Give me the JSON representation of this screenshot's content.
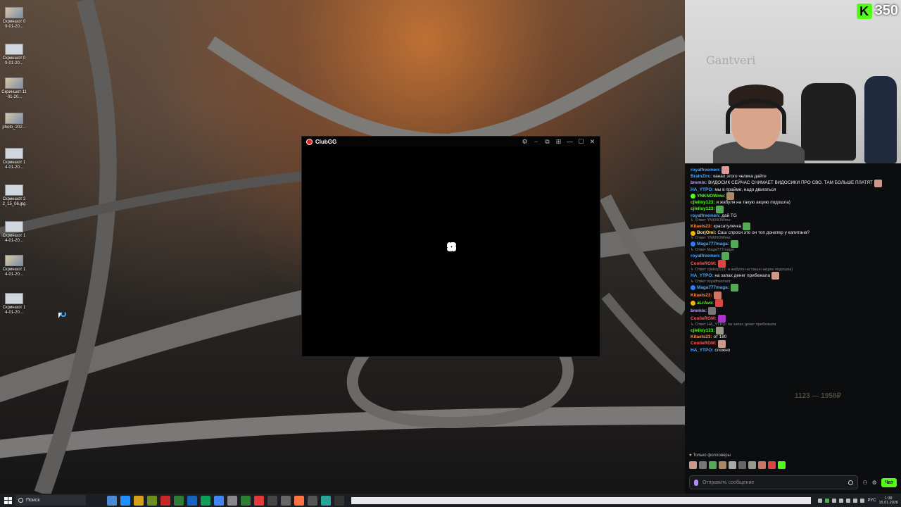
{
  "desktop": {
    "icons": [
      {
        "label": "Скриншот 09-01-20..."
      },
      {
        "label": "Скриншот 09-01-20..."
      },
      {
        "label": "Скриншот 11-01-20..."
      },
      {
        "label": "photo_202..."
      },
      {
        "label": "Скриншот 14-01-20..."
      },
      {
        "label": "Скриншот 22_15_06.jpg"
      },
      {
        "label": "Скриншот 14-01-20..."
      },
      {
        "label": "Скриншот 14-01-20..."
      },
      {
        "label": "Скриншот 14-01-20..."
      }
    ]
  },
  "app_window": {
    "title": "ClubGG",
    "controls": {
      "settings": "⚙",
      "pin": "⎯",
      "restore": "⧉",
      "grid": "⊞",
      "minimize": "—",
      "maximize": "☐",
      "close": "✕"
    }
  },
  "stream": {
    "platform_icon": "K",
    "viewer_count": "350",
    "wall_text": "Gantveri"
  },
  "chat": {
    "messages": [
      {
        "user": "royalfreemen:",
        "text": "",
        "color": "#4da6ff",
        "emote": "#d99"
      },
      {
        "user": "BrainZirc:",
        "text": "канал этого челика дайте",
        "color": "#4da6ff"
      },
      {
        "user": "bremix:",
        "text": "ВИДОСИК СЕЙЧАС СНИМАЕТ ВИДОСИКИ ПРО СВО. ТАМ БОЛЬШЕ ПЛАТЯТ",
        "color": "#c9a0ff",
        "emote": "#c98"
      },
      {
        "user": "HA_YTPO:",
        "text": "мы в прайме, надо двигаться",
        "color": "#4da6ff"
      },
      {
        "user": "YNKNOWme:",
        "text": "",
        "color": "#53fc18",
        "emote": "#a86",
        "badge": "#53fc18"
      },
      {
        "user": "cjleiloy123:",
        "text": "и жабуля на такую акцию подошла)",
        "color": "#53fc18"
      },
      {
        "user": "cjleiloy123:",
        "text": "",
        "color": "#53fc18",
        "emote": "#5a5"
      },
      {
        "user": "royalfreemen:",
        "text": "дай TG",
        "color": "#4da6ff"
      },
      {
        "reply": "Ответ YNKNOWme:"
      },
      {
        "user": "Kitaets23:",
        "text": "красатулечка",
        "color": "#ff8c42",
        "emote": "#5a5"
      },
      {
        "user": "BorjOmi:",
        "text": "Саш спроси это он топ донатер у капитана?",
        "color": "#ffe36e",
        "badge": "#f5b400"
      },
      {
        "reply": "Ответ YNKNOWme:"
      },
      {
        "user": "Maga777maga:",
        "text": "",
        "color": "#4da6ff",
        "emote": "#5a5",
        "badge": "#2d7cff"
      },
      {
        "reply": "Ответ Maga777maga:"
      },
      {
        "user": "royalfreemen:",
        "text": "",
        "color": "#4da6ff",
        "emote": "#5a5"
      },
      {
        "user": "CoolieRGM:",
        "text": "",
        "color": "#ff5c5c",
        "emote": "#d44"
      },
      {
        "reply": "Ответ cjleiloy123: и жабуля на такую акцию подошла)"
      },
      {
        "user": "HA_YTPO:",
        "text": "на запах денег прибежала",
        "color": "#4da6ff",
        "emote": "#c98"
      },
      {
        "reply": "Ответ royalfreemen:"
      },
      {
        "user": "Maga777maga:",
        "text": "",
        "color": "#4da6ff",
        "emote": "#5a5",
        "badge": "#2d7cff"
      },
      {
        "user": "Kitaets23:",
        "text": "",
        "color": "#ff8c42",
        "emote": "#c76"
      },
      {
        "user": "aLrAvo:",
        "text": "",
        "color": "#53fc18",
        "emote": "#d44",
        "badge": "#f5b400"
      },
      {
        "user": "bremix:",
        "text": "",
        "color": "#c9a0ff",
        "emote": "#777"
      },
      {
        "user": "CoolieRGM:",
        "text": "",
        "color": "#ff5c5c",
        "emote": "#a3c"
      },
      {
        "reply": "Ответ HA_YTPO: на запах денег прибежала"
      },
      {
        "user": "cjleiloy123:",
        "text": "",
        "color": "#53fc18",
        "emote": "#998"
      },
      {
        "user": "Kitaets23:",
        "text": "от 180",
        "color": "#ff8c42"
      },
      {
        "user": "CoolieRGM:",
        "text": "",
        "color": "#ff5c5c",
        "emote": "#c98"
      },
      {
        "user": "HA_YTPO:",
        "text": "сложно",
        "color": "#4da6ff"
      }
    ],
    "donation_amount": "1123 — 1958₽",
    "followers_only": "Только фолловеры",
    "input_placeholder": "Отправить сообщение",
    "send_label": "Чат"
  },
  "taskbar": {
    "search_label": "Поиск",
    "apps": [
      "#4b8bd6",
      "#1e90ff",
      "#d4a017",
      "#6b8e23",
      "#c62828",
      "#2e7d32",
      "#1565c0",
      "#0f9d58",
      "#4285f4",
      "#888888",
      "#2e7d32",
      "#e53935",
      "#444444",
      "#666666",
      "#ff7043",
      "#555555",
      "#26a69a",
      "#333333"
    ],
    "language": "РУС",
    "time": "1:38",
    "date": "15.01.2026"
  }
}
